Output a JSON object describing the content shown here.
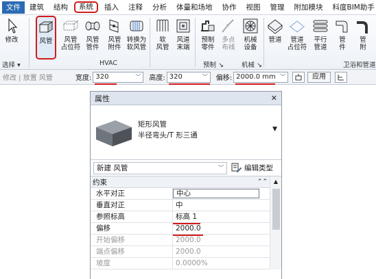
{
  "ribbon_tabs": [
    "文件",
    "建筑",
    "结构",
    "系统",
    "插入",
    "注释",
    "分析",
    "体量和场地",
    "协作",
    "视图",
    "管理",
    "附加模块",
    "科度BIM助手"
  ],
  "active_tab": "系统",
  "ribbon": {
    "buttons": [
      {
        "label": "修改",
        "icon": "cursor-arrow-icon"
      },
      {
        "label": "风管",
        "icon": "duct-icon",
        "selected": true
      },
      {
        "label": "风管\n占位符",
        "icon": "duct-placeholder-icon"
      },
      {
        "label": "风管\n管件",
        "icon": "duct-fitting-icon"
      },
      {
        "label": "风管\n附件",
        "icon": "duct-accessory-icon"
      },
      {
        "label": "转换为\n软风管",
        "icon": "convert-flex-duct-icon"
      },
      {
        "label": "软\n风管",
        "icon": "flex-duct-icon"
      },
      {
        "label": "风道\n末端",
        "icon": "air-terminal-icon"
      },
      {
        "label": "预制\n零件",
        "icon": "fabrication-part-icon"
      },
      {
        "label": "多点\n布线",
        "icon": "multipoint-routing-icon"
      },
      {
        "label": "机械\n设备",
        "icon": "mechanical-equipment-icon"
      },
      {
        "label": "管道",
        "icon": "pipe-icon"
      },
      {
        "label": "管道\n占位符",
        "icon": "pipe-placeholder-icon"
      },
      {
        "label": "平行\n管道",
        "icon": "parallel-pipes-icon"
      },
      {
        "label": "管\n件",
        "icon": "pipe-fitting-icon"
      },
      {
        "label": "管\n附",
        "icon": "pipe-accessory-icon"
      }
    ],
    "groups": {
      "select": "选择 ▾",
      "hvac": "HVAC",
      "fabrication": "预制 ↘",
      "mechanical": "机械 ↘",
      "plumbing": "卫浴和管道"
    }
  },
  "options_bar": {
    "breadcrumb": "修改 | 放置 风管",
    "width_label": "宽度:",
    "width_value": "320",
    "height_label": "高度:",
    "height_value": "320",
    "offset_label": "偏移:",
    "offset_value": "2000.0 mm",
    "apply_label": "应用"
  },
  "properties": {
    "title": "属性",
    "close": "✕",
    "type_name_line1": "矩形风管",
    "type_name_line2": "半径弯头/T 形三通",
    "instance_filter": "新建 风管",
    "edit_type": "编辑类型",
    "section": "约束",
    "rows": [
      {
        "key": "水平对正",
        "value": "中心",
        "editable": true,
        "boxed": true
      },
      {
        "key": "垂直对正",
        "value": "中",
        "editable": true
      },
      {
        "key": "参照标高",
        "value": "标高 1",
        "editable": true,
        "highlight": true
      },
      {
        "key": "偏移",
        "value": "2000.0",
        "editable": true,
        "highlight": true
      },
      {
        "key": "开始偏移",
        "value": "2000.0",
        "editable": false
      },
      {
        "key": "端点偏移",
        "value": "2000.0",
        "editable": false
      },
      {
        "key": "坡度",
        "value": "0.0000%",
        "editable": false
      }
    ]
  },
  "colors": {
    "highlight_red": "#d11a1a",
    "file_tab_blue": "#2b6bb3"
  }
}
